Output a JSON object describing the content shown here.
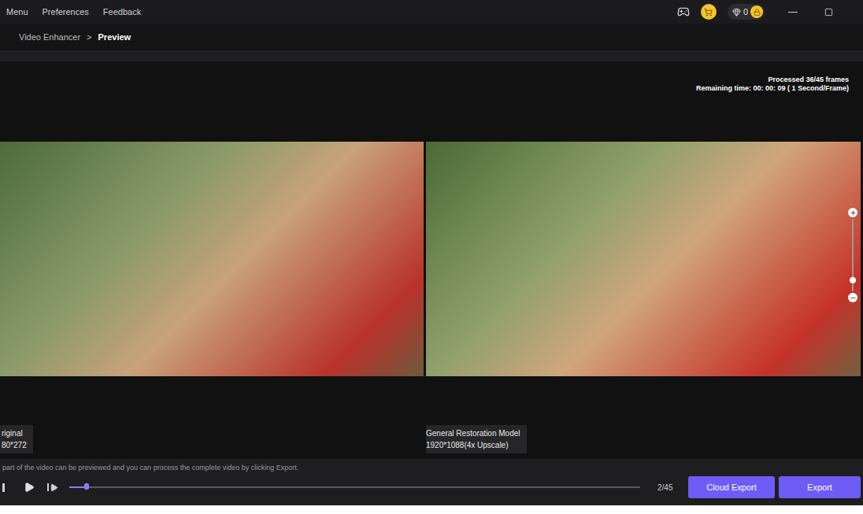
{
  "menu": [
    {
      "label": "Menu"
    },
    {
      "label": "Preferences"
    },
    {
      "label": "Feedback"
    }
  ],
  "account": {
    "gems": "0"
  },
  "breadcrumb": {
    "parent": "Video Enhancer",
    "separator": ">",
    "current": "Preview"
  },
  "progress": {
    "processed": "Processed 36/45 frames",
    "remaining": "Remaining time: 00: 00: 09 ( 1 Second/Frame)"
  },
  "panels": [
    {
      "title": "riginal",
      "resolution": "80*272"
    },
    {
      "title": "General Restoration Model",
      "resolution": "1920*1088(4x Upscale)"
    }
  ],
  "zoom": {
    "level": 0.15
  },
  "hint": "part of the video can be previewed and you can process the complete video by clicking Export.",
  "timeline": {
    "level": 0.03,
    "counter": "2/45"
  },
  "buttons": [
    {
      "label": "Cloud Export"
    },
    {
      "label": "Export"
    }
  ]
}
